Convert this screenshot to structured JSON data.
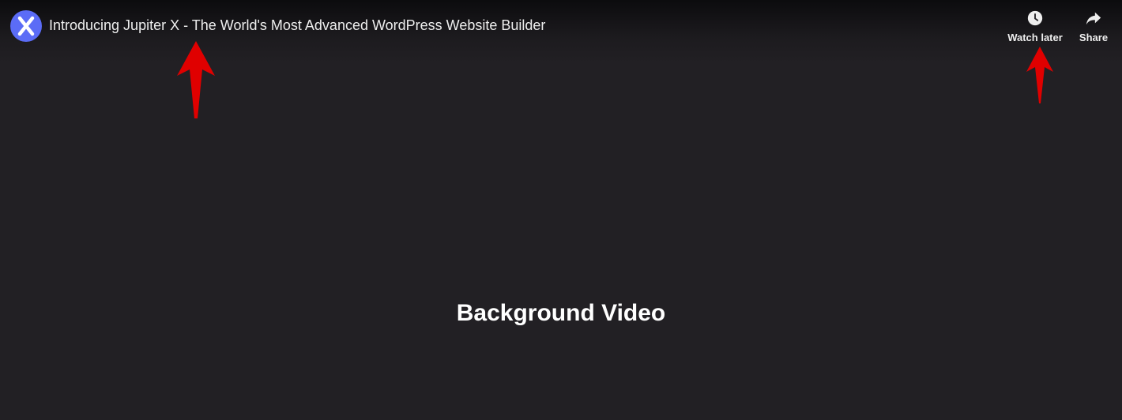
{
  "video": {
    "title": "Introducing Jupiter X - The World's Most Advanced WordPress Website Builder",
    "channel_logo_letter": "X"
  },
  "actions": {
    "watch_later": {
      "label": "Watch later",
      "icon": "clock-icon"
    },
    "share": {
      "label": "Share",
      "icon": "share-arrow-icon"
    }
  },
  "content": {
    "caption": "Background Video"
  },
  "colors": {
    "background": "#222024",
    "avatar": "#5b6cf6",
    "annotation": "#e00000",
    "text": "#eeeeee"
  }
}
